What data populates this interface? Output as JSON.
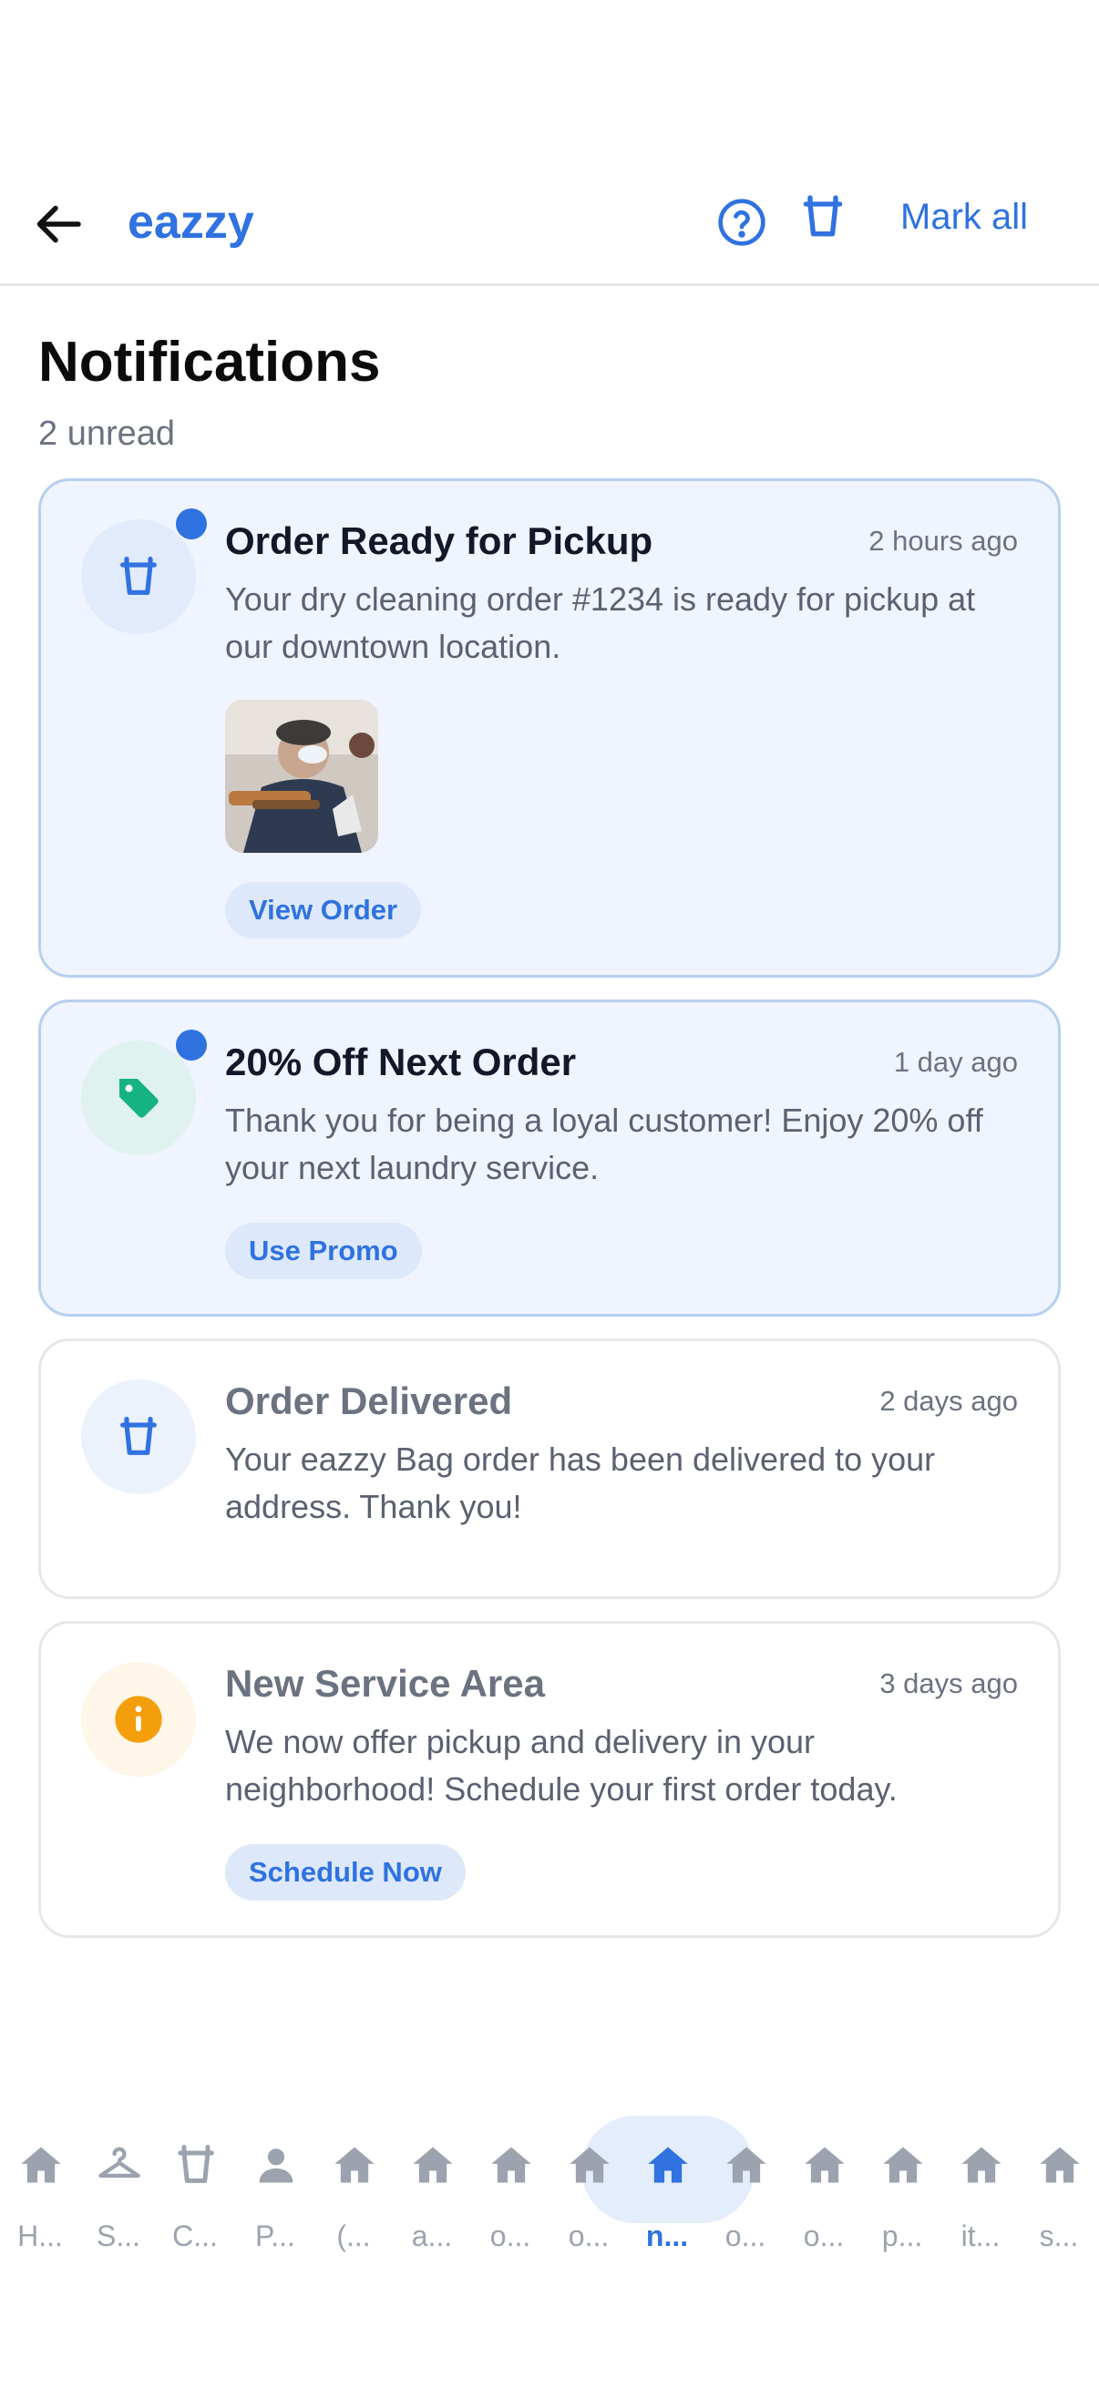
{
  "header": {
    "brand": "eazzy",
    "mark_all_label": "Mark all",
    "back_icon": "arrow-left-icon",
    "help_icon": "help-circle-icon",
    "bag_icon": "bag-icon"
  },
  "page": {
    "title": "Notifications",
    "unread_count": "2 unread"
  },
  "notifications": [
    {
      "title": "Order Ready for Pickup",
      "time": "2 hours ago",
      "body": "Your dry cleaning order #1234 is ready for pickup at our downtown location.",
      "action": "View Order",
      "icon": "bag-icon",
      "unread": true,
      "has_image": true
    },
    {
      "title": "20% Off Next Order",
      "time": "1 day ago",
      "body": "Thank you for being a loyal customer! Enjoy 20% off your next laundry service.",
      "action": "Use Promo",
      "icon": "tag-icon",
      "unread": true
    },
    {
      "title": "Order Delivered",
      "time": "2 days ago",
      "body": "Your eazzy Bag order has been delivered to your address. Thank you!",
      "icon": "bag-icon",
      "unread": false
    },
    {
      "title": "New Service Area",
      "time": "3 days ago",
      "body": "We now offer pickup and delivery in your neighborhood! Schedule your first order today.",
      "action": "Schedule Now",
      "icon": "info-icon",
      "unread": false
    }
  ],
  "bottom_nav": [
    {
      "label": "H...",
      "icon": "home-icon"
    },
    {
      "label": "S...",
      "icon": "hanger-icon"
    },
    {
      "label": "C...",
      "icon": "bag-icon"
    },
    {
      "label": "P...",
      "icon": "person-icon"
    },
    {
      "label": "(...",
      "icon": "home-icon"
    },
    {
      "label": "a...",
      "icon": "home-icon"
    },
    {
      "label": "o...",
      "icon": "home-icon"
    },
    {
      "label": "o...",
      "icon": "home-icon"
    },
    {
      "label": "n...",
      "icon": "home-icon",
      "active": true
    },
    {
      "label": "o...",
      "icon": "home-icon"
    },
    {
      "label": "o...",
      "icon": "home-icon"
    },
    {
      "label": "p...",
      "icon": "home-icon"
    },
    {
      "label": "it...",
      "icon": "home-icon"
    },
    {
      "label": "s...",
      "icon": "home-icon"
    }
  ],
  "colors": {
    "accent": "#2f72e0",
    "unread_bg": "#eff4fe",
    "promo_green": "#16b382",
    "info_orange": "#f59e0b"
  }
}
